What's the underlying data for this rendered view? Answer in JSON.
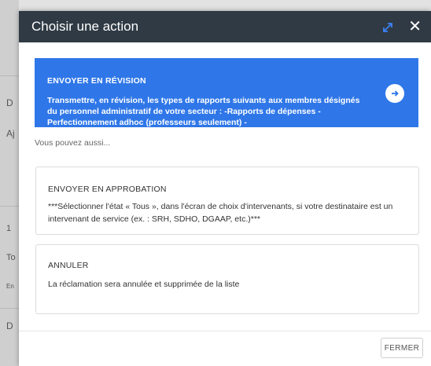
{
  "background": {
    "fragments": [
      "D",
      "Aj",
      "1",
      "To",
      "En",
      "D"
    ]
  },
  "dialog": {
    "title": "Choisir une action",
    "primary_action": {
      "title": "ENVOYER EN RÉVISION",
      "description": "Transmettre, en révision, les types de rapports suivants aux membres désignés du personnel administratif de votre secteur : -Rapports de dépenses -Perfectionnement adhoc (professeurs seulement) -"
    },
    "also_text": "Vous pouvez aussi...",
    "options": [
      {
        "title": "ENVOYER EN APPROBATION",
        "description": "***Sélectionner l'état « Tous », dans l'écran de choix d'intervenants, si votre destinataire est un intervenant de service (ex. : SRH, SDHO, DGAAP, etc.)***"
      },
      {
        "title": "ANNULER",
        "description": "La réclamation sera annulée et supprimée de la liste"
      }
    ],
    "close_label": "FERMER"
  },
  "colors": {
    "header": "#2f3a44",
    "primary": "#2f77e8",
    "expand_icon": "#3b82f6"
  }
}
